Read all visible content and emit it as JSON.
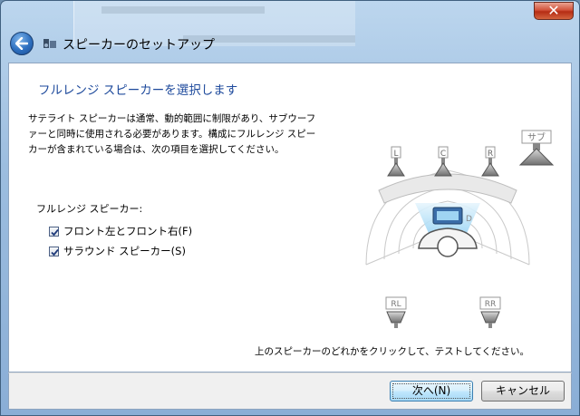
{
  "window": {
    "title": "スピーカーのセットアップ",
    "close_label": "✕"
  },
  "page": {
    "heading": "フルレンジ スピーカーを選択します",
    "description": "サテライト スピーカーは通常、動的範囲に制限があり、サブウーフ\nァーと同時に使用される必要があります。構成にフルレンジ スピー\nカーが含まれている場合は、次の項目を選択してください。",
    "fullrange_label": "フルレンジ スピーカー:",
    "checkboxes": [
      {
        "label": "フロント左とフロント右(F)",
        "checked": true
      },
      {
        "label": "サラウンド スピーカー(S)",
        "checked": true
      }
    ],
    "instruction": "上のスピーカーのどれかをクリックして、テストしてください。"
  },
  "speakers": {
    "front_left": "L",
    "center": "C",
    "front_right": "R",
    "subwoofer": "サブ",
    "rear_left": "RL",
    "rear_right": "RR"
  },
  "buttons": {
    "next": "次へ(N)",
    "cancel": "キャンセル"
  },
  "colors": {
    "heading": "#1e4a9c",
    "highlight": "#bfe3f8"
  }
}
